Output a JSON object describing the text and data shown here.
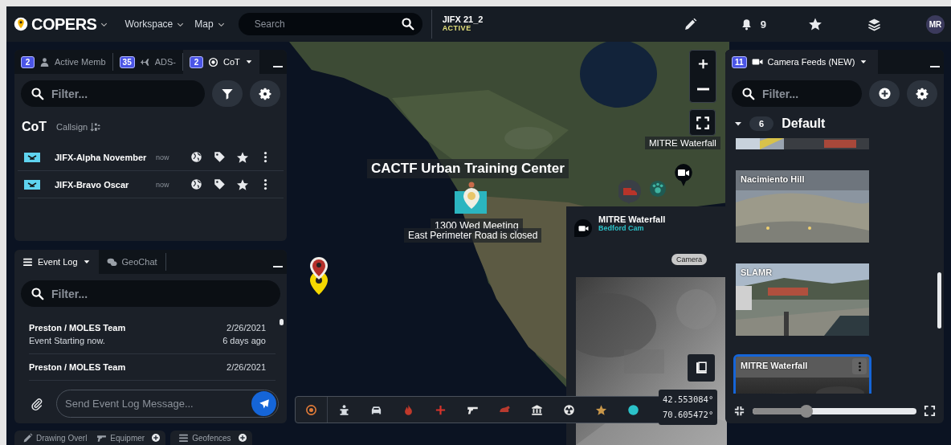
{
  "header": {
    "brand": "COPERS",
    "menus": [
      {
        "label": "Workspace"
      },
      {
        "label": "Map"
      }
    ],
    "search": {
      "placeholder": "Search"
    },
    "event": {
      "name": "JIFX 21_2",
      "status": "ACTIVE"
    },
    "notifications": {
      "count": "9"
    },
    "user": {
      "initials": "MR"
    }
  },
  "cot_panel": {
    "tabs": [
      {
        "kind": "members",
        "badge": "2",
        "label": "Active Memb",
        "selected": false
      },
      {
        "kind": "aircraft",
        "badge": "35",
        "label": "ADS-",
        "selected": false
      },
      {
        "kind": "cot",
        "badge": "2",
        "label": "CoT",
        "selected": true
      }
    ],
    "filter": {
      "placeholder": "Filter..."
    },
    "heading": "CoT",
    "sort": {
      "label": "Callsign"
    },
    "rows": [
      {
        "callsign": "JIFX-Alpha November",
        "time": "now"
      },
      {
        "callsign": "JIFX-Bravo Oscar",
        "time": "now"
      }
    ]
  },
  "event_log": {
    "tabs": [
      {
        "kind": "log",
        "label": "Event Log",
        "selected": true
      },
      {
        "kind": "chat",
        "label": "GeoChat",
        "selected": false
      }
    ],
    "filter": {
      "placeholder": "Filter..."
    },
    "entries": [
      {
        "author": "Preston / MOLES Team",
        "date": "2/26/2021",
        "message": "Event Starting now.",
        "age": "6 days ago"
      },
      {
        "author": "Preston / MOLES Team",
        "date": "2/26/2021"
      }
    ],
    "composer": {
      "placeholder": "Send Event Log Message..."
    }
  },
  "bottom_tabs": [
    {
      "kind": "drawing",
      "label": "Drawing Overl"
    },
    {
      "kind": "equipment",
      "label": "Equipmer"
    },
    {
      "kind": "geofence",
      "label": "Geofences"
    }
  ],
  "map": {
    "labels": [
      {
        "text": "CACTF Urban Training Center"
      },
      {
        "text": "1300 Wed Meeting"
      },
      {
        "text": "East Perimeter Road is closed"
      },
      {
        "text": "MITRE Waterfall"
      }
    ],
    "popup": {
      "title": "MITRE Waterfall",
      "subtitle": "Bedford Cam",
      "tag": "Camera"
    },
    "tools": [
      {
        "kind": "target"
      },
      {
        "kind": "lift"
      },
      {
        "kind": "vehicle"
      },
      {
        "kind": "fire"
      },
      {
        "kind": "medical"
      },
      {
        "kind": "weapon"
      },
      {
        "kind": "animal"
      },
      {
        "kind": "building"
      },
      {
        "kind": "radiation"
      },
      {
        "kind": "star"
      },
      {
        "kind": "dot"
      }
    ],
    "coordinates": {
      "latitude": "42.553084°",
      "longitude": "70.605472°"
    }
  },
  "camera_panel": {
    "badge": "11",
    "title": "Camera Feeds (NEW)",
    "filter": {
      "placeholder": "Filter..."
    },
    "group": {
      "count": "6",
      "name": "Default",
      "expanded": true
    },
    "feeds": [
      {
        "selected": false
      },
      {
        "label": "Nacimiento Hill",
        "selected": false
      },
      {
        "label": "SLAMR",
        "selected": false
      },
      {
        "label": "MITRE Waterfall",
        "selected": true
      }
    ],
    "zoom_slider": {
      "level": 0.33
    }
  }
}
